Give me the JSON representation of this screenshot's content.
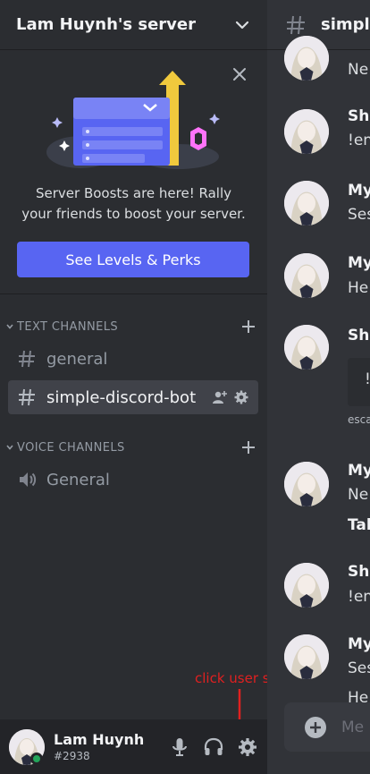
{
  "server": {
    "name": "Lam Huynh's server"
  },
  "boost": {
    "line1": "Server Boosts are here! Rally",
    "line2": "your friends to boost your server.",
    "button_label": "See Levels & Perks"
  },
  "categories": {
    "text": "TEXT CHANNELS",
    "voice": "VOICE CHANNELS"
  },
  "channels": {
    "text": [
      {
        "label": "general",
        "active": false
      },
      {
        "label": "simple-discord-bot",
        "active": true
      }
    ],
    "voice": [
      {
        "label": "General"
      }
    ]
  },
  "user": {
    "name": "Lam Huynh",
    "tag": "#2938",
    "status_color": "#23a55a"
  },
  "annotation": {
    "text": "click user setting",
    "color": "#e02020"
  },
  "chat": {
    "title": "simple",
    "messages": [
      {
        "name": "",
        "text": "Ne"
      },
      {
        "name": "Shi",
        "text": "!en"
      },
      {
        "name": "My",
        "text": "Ses"
      },
      {
        "name": "My",
        "text": "He"
      },
      {
        "name": "Shi",
        "text": "",
        "embed_text": "!",
        "small": "esca"
      },
      {
        "name": "My",
        "text": "Ne",
        "bold": "Tal"
      },
      {
        "name": "Shi",
        "text": "!en"
      },
      {
        "name": "My",
        "text": "Ses",
        "extra": "He"
      }
    ],
    "composer_placeholder": "Me"
  },
  "colors": {
    "accent": "#5865f2",
    "sidebar": "#2b2d31",
    "chat": "#313338",
    "user_panel": "#232428"
  }
}
